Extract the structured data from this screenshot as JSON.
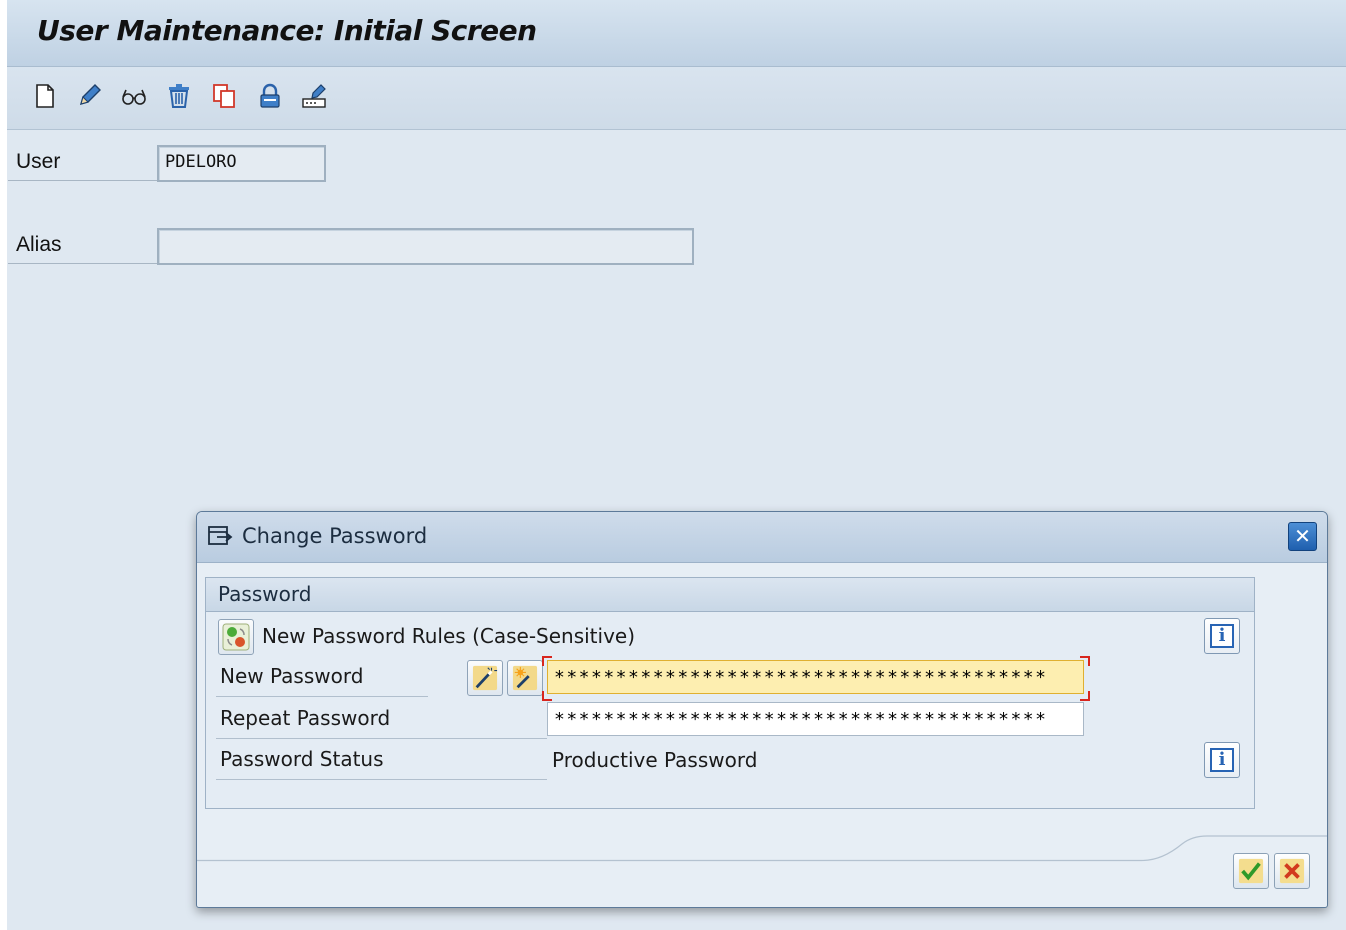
{
  "window": {
    "title": "User Maintenance: Initial Screen"
  },
  "toolbar": {
    "icons": [
      "create-icon",
      "change-icon",
      "display-icon",
      "delete-icon",
      "copy-icon",
      "lock-icon",
      "change-password-icon"
    ]
  },
  "form": {
    "user_label": "User",
    "user_value": "PDELORO",
    "alias_label": "Alias",
    "alias_value": ""
  },
  "dialog": {
    "title": "Change Password",
    "group_title": "Password",
    "rules_text": "New Password Rules (Case-Sensitive)",
    "new_password_label": "New Password",
    "new_password_value": "****************************************",
    "repeat_password_label": "Repeat Password",
    "repeat_password_value": "****************************************",
    "status_label": "Password Status",
    "status_value": "Productive Password"
  },
  "colors": {
    "accent": "#1f5fae",
    "focus_field": "#fdeeb0",
    "confirm": "#2e9a2a",
    "cancel": "#d23a1e"
  }
}
